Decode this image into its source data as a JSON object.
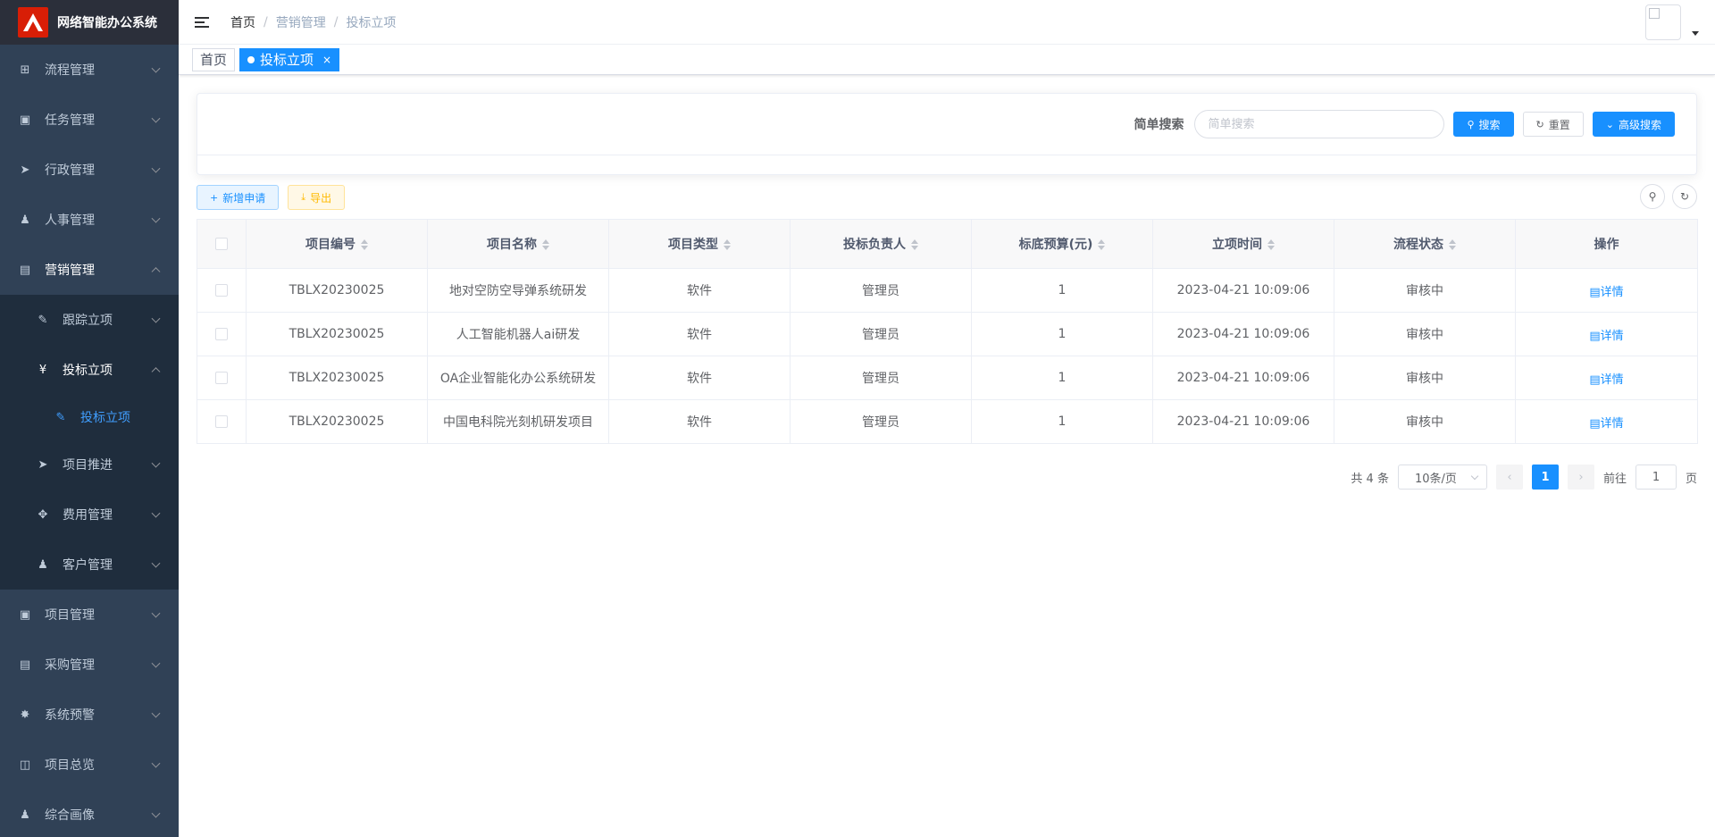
{
  "app": {
    "title": "网络智能办公系统"
  },
  "sidebar": {
    "items": [
      {
        "label": "流程管理",
        "icon": "flow-icon"
      },
      {
        "label": "任务管理",
        "icon": "task-icon"
      },
      {
        "label": "行政管理",
        "icon": "send-icon"
      },
      {
        "label": "人事管理",
        "icon": "people-icon"
      },
      {
        "label": "营销管理",
        "icon": "chart-icon",
        "open": true
      },
      {
        "label": "项目管理",
        "icon": "project-icon"
      },
      {
        "label": "采购管理",
        "icon": "cart-icon"
      },
      {
        "label": "系统预警",
        "icon": "bug-icon"
      },
      {
        "label": "项目总览",
        "icon": "book-icon"
      },
      {
        "label": "综合画像",
        "icon": "user-icon"
      }
    ],
    "marketing_sub": [
      {
        "label": "跟踪立项",
        "icon": "edit-icon"
      },
      {
        "label": "投标立项",
        "icon": "yen-icon",
        "open": true
      },
      {
        "label": "项目推进",
        "icon": "send-icon"
      },
      {
        "label": "费用管理",
        "icon": "move-icon"
      },
      {
        "label": "客户管理",
        "icon": "people-icon"
      }
    ],
    "bid_sub": [
      {
        "label": "投标立项",
        "icon": "edit-icon"
      }
    ]
  },
  "breadcrumb": [
    "首页",
    "营销管理",
    "投标立项"
  ],
  "tags": [
    {
      "label": "首页",
      "active": false
    },
    {
      "label": "投标立项",
      "active": true,
      "close": "×"
    }
  ],
  "search": {
    "label": "简单搜索",
    "placeholder": "简单搜索",
    "search_btn": "搜索",
    "reset_btn": "重置",
    "advanced_btn": "高级搜索"
  },
  "toolbar": {
    "add_btn": "新增申请",
    "export_btn": "导出"
  },
  "table": {
    "columns": [
      "项目编号",
      "项目名称",
      "项目类型",
      "投标负责人",
      "标底预算(元)",
      "立项时间",
      "流程状态",
      "操作"
    ],
    "rows": [
      {
        "code": "TBLX20230025",
        "name": "地对空防空导弹系统研发",
        "type": "软件",
        "owner": "管理员",
        "budget": "1",
        "time": "2023-04-21 10:09:06",
        "status": "审核中",
        "action": "详情"
      },
      {
        "code": "TBLX20230025",
        "name": "人工智能机器人ai研发",
        "type": "软件",
        "owner": "管理员",
        "budget": "1",
        "time": "2023-04-21 10:09:06",
        "status": "审核中",
        "action": "详情"
      },
      {
        "code": "TBLX20230025",
        "name": "OA企业智能化办公系统研发",
        "type": "软件",
        "owner": "管理员",
        "budget": "1",
        "time": "2023-04-21 10:09:06",
        "status": "审核中",
        "action": "详情"
      },
      {
        "code": "TBLX20230025",
        "name": "中国电科院光刻机研发项目",
        "type": "软件",
        "owner": "管理员",
        "budget": "1",
        "time": "2023-04-21 10:09:06",
        "status": "审核中",
        "action": "详情"
      }
    ]
  },
  "pagination": {
    "total": "共 4 条",
    "page_size": "10条/页",
    "current": "1",
    "goto_label": "前往",
    "goto_value": "1",
    "page_suffix": "页"
  },
  "colors": {
    "primary": "#1890ff",
    "sidebar_bg": "#304156",
    "logo_red": "#d81e06"
  }
}
